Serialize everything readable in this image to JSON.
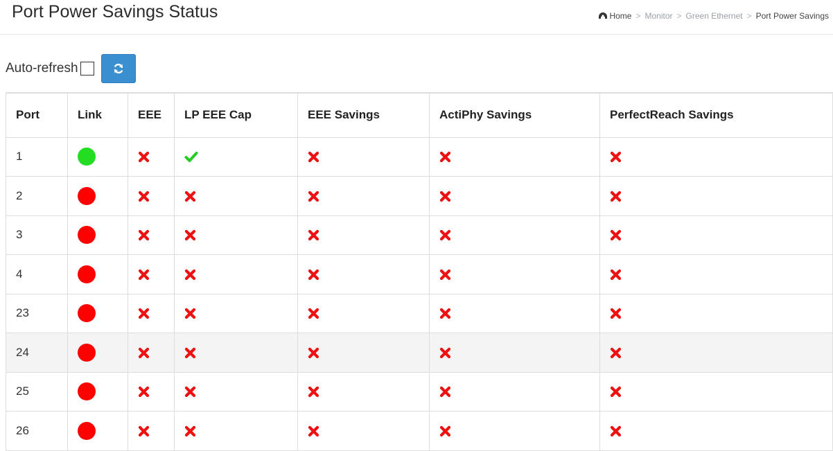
{
  "header": {
    "title": "Port Power Savings Status",
    "breadcrumb": [
      "Home",
      "Monitor",
      "Green Ethernet",
      "Port Power Savings"
    ]
  },
  "toolbar": {
    "auto_refresh_label": "Auto-refresh",
    "auto_refresh_checked": false,
    "refresh_icon": "refresh-icon"
  },
  "colors": {
    "link_up": "#22dd22",
    "link_down": "#ff0000",
    "cross": "#ee1111",
    "check": "#22cc22",
    "button": "#3a8fd0"
  },
  "table": {
    "headers": [
      "Port",
      "Link",
      "EEE",
      "LP EEE Cap",
      "EEE Savings",
      "ActiPhy Savings",
      "PerfectReach Savings"
    ],
    "rows": [
      {
        "port": "1",
        "link": "up",
        "eee": "no",
        "lp_eee_cap": "yes",
        "eee_savings": "no",
        "actiphy_savings": "no",
        "perfectreach_savings": "no"
      },
      {
        "port": "2",
        "link": "down",
        "eee": "no",
        "lp_eee_cap": "no",
        "eee_savings": "no",
        "actiphy_savings": "no",
        "perfectreach_savings": "no"
      },
      {
        "port": "3",
        "link": "down",
        "eee": "no",
        "lp_eee_cap": "no",
        "eee_savings": "no",
        "actiphy_savings": "no",
        "perfectreach_savings": "no"
      },
      {
        "port": "4",
        "link": "down",
        "eee": "no",
        "lp_eee_cap": "no",
        "eee_savings": "no",
        "actiphy_savings": "no",
        "perfectreach_savings": "no"
      },
      {
        "port": "23",
        "link": "down",
        "eee": "no",
        "lp_eee_cap": "no",
        "eee_savings": "no",
        "actiphy_savings": "no",
        "perfectreach_savings": "no"
      },
      {
        "port": "24",
        "link": "down",
        "eee": "no",
        "lp_eee_cap": "no",
        "eee_savings": "no",
        "actiphy_savings": "no",
        "perfectreach_savings": "no"
      },
      {
        "port": "25",
        "link": "down",
        "eee": "no",
        "lp_eee_cap": "no",
        "eee_savings": "no",
        "actiphy_savings": "no",
        "perfectreach_savings": "no"
      },
      {
        "port": "26",
        "link": "down",
        "eee": "no",
        "lp_eee_cap": "no",
        "eee_savings": "no",
        "actiphy_savings": "no",
        "perfectreach_savings": "no"
      }
    ]
  }
}
